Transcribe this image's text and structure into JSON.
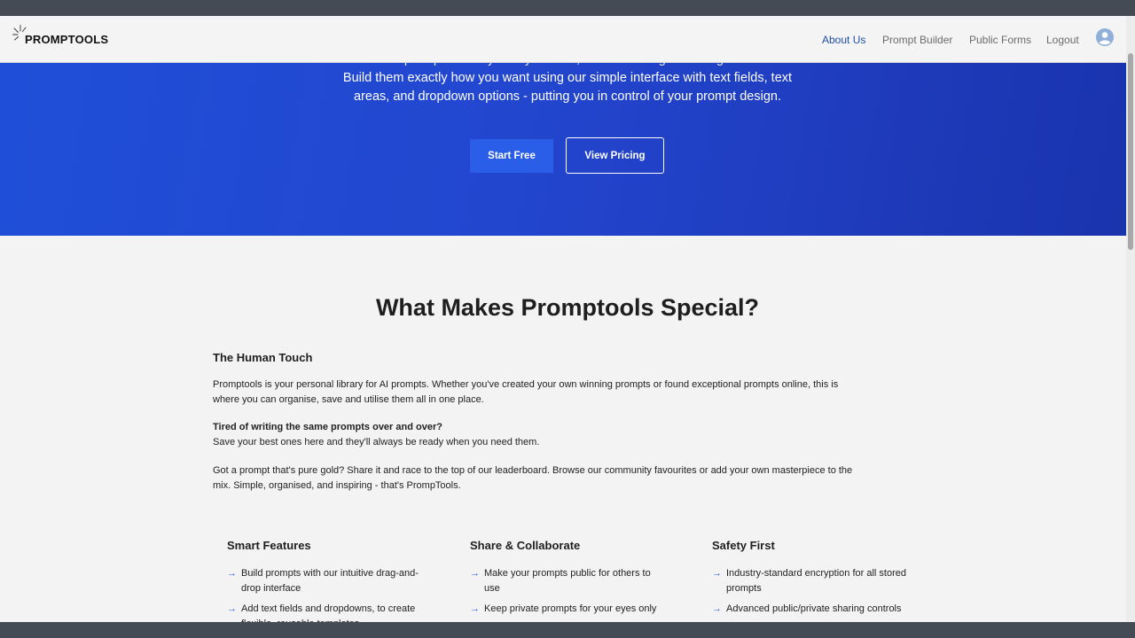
{
  "header": {
    "brand": "PROMPTOOLS",
    "nav": [
      "About Us",
      "Prompt Builder",
      "Public Forms",
      "Logout"
    ],
    "active_nav": "About Us"
  },
  "hero": {
    "partial_line": "…prompts exactly how you want, without coding knowledge…",
    "line1": "Build them exactly how you want using our simple interface with text fields, text",
    "line2": "areas, and dropdown options - putting you in control of your prompt design.",
    "start_button": "Start Free",
    "pricing_button": "View Pricing"
  },
  "main": {
    "title": "What Makes Promptools Special?",
    "subhead": "The Human Touch",
    "para1_line1": "Promptools is your personal library for AI prompts. Whether you've created your own winning prompts or found exceptional prompts online, this is",
    "para1_line2": "where you can organise, save and utilise them all in one place.",
    "para2_bold": "Tired of writing the same prompts over and over?",
    "para2_text": "Save your best ones here and they'll always be ready when you need them.",
    "para3_line1": "Got a prompt that's pure gold? Share it and race to the top of our leaderboard. Browse our community favourites or add your own masterpiece to the",
    "para3_line2": "mix. Simple, organised, and inspiring - that's PrompTools."
  },
  "features": [
    {
      "title": "Smart Features",
      "items": [
        "Build prompts with our intuitive drag-and-drop interface",
        "Add text fields and dropdowns, to create flexible, reusable templates"
      ]
    },
    {
      "title": "Share & Collaborate",
      "items": [
        "Make your prompts public for others to use",
        "Keep private prompts for your eyes only"
      ]
    },
    {
      "title": "Safety First",
      "items": [
        "Industry-standard encryption for all stored prompts",
        "Advanced public/private sharing controls"
      ]
    }
  ],
  "colors": {
    "hero_blue": "#2346cf",
    "accent_blue": "#2a5ee8",
    "active_nav": "#1f4ea8",
    "chrome": "#444b55"
  },
  "icons": {
    "logo": "sparkle-lines-icon",
    "profile": "user-circle-icon",
    "bullet": "arrow-right-icon"
  }
}
